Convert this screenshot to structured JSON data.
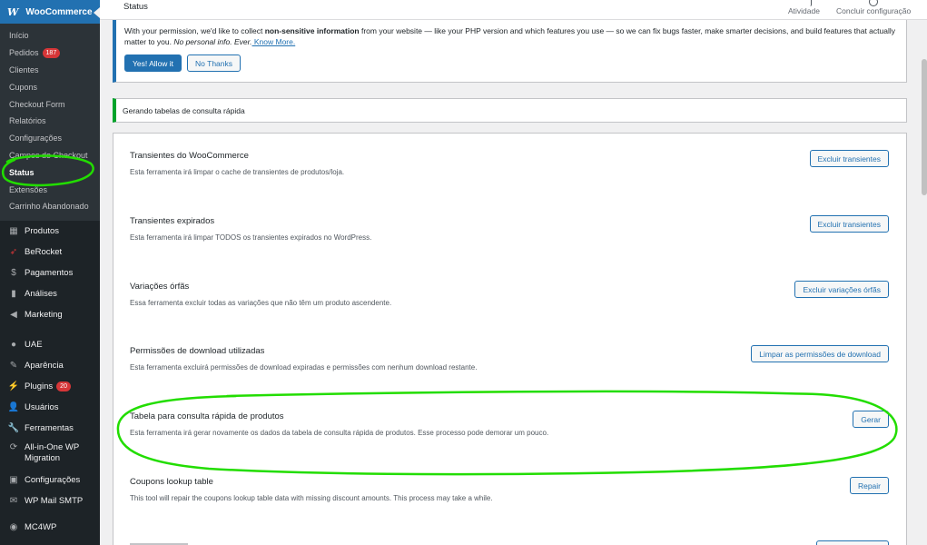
{
  "sidebar": {
    "woocommerce_label": "WooCommerce",
    "sub_items": [
      {
        "label": "Início"
      },
      {
        "label": "Pedidos",
        "badge": "187"
      },
      {
        "label": "Clientes"
      },
      {
        "label": "Cupons"
      },
      {
        "label": "Checkout Form"
      },
      {
        "label": "Relatórios"
      },
      {
        "label": "Configurações"
      },
      {
        "label": "Campos do Checkout"
      },
      {
        "label": "Status"
      },
      {
        "label": "Extensões"
      },
      {
        "label": "Carrinho Abandonado"
      }
    ],
    "menu_items": [
      {
        "label": "Produtos",
        "icon": "products-icon"
      },
      {
        "label": "BeRocket",
        "icon": "berocket-icon"
      },
      {
        "label": "Pagamentos",
        "icon": "payments-icon"
      },
      {
        "label": "Análises",
        "icon": "analytics-icon"
      },
      {
        "label": "Marketing",
        "icon": "marketing-icon"
      },
      {
        "label": "UAE",
        "icon": "uae-icon"
      },
      {
        "label": "Aparência",
        "icon": "appearance-icon"
      },
      {
        "label": "Plugins",
        "icon": "plugins-icon",
        "badge": "20"
      },
      {
        "label": "Usuários",
        "icon": "users-icon"
      },
      {
        "label": "Ferramentas",
        "icon": "tools-icon"
      },
      {
        "label": "All-in-One WP",
        "label2": "Migration",
        "icon": "migration-icon"
      },
      {
        "label": "Configurações",
        "icon": "settings-icon"
      },
      {
        "label": "WP Mail SMTP",
        "icon": "mail-icon"
      },
      {
        "label": "MC4WP",
        "icon": "mc4wp-icon"
      }
    ]
  },
  "topbar": {
    "title": "Status",
    "activity": "Atividade",
    "finish_setup": "Concluir configuração"
  },
  "tracker_notice": {
    "text_1": "With your permission, we'd like to collect ",
    "text_bold": "non-sensitive information",
    "text_2": " from your website — like your PHP version and which features you use — so we can fix bugs faster, make smarter decisions, and build features that actually matter to you. ",
    "text_em": "No personal info. Ever.",
    "link": " Know More.",
    "allow_label": "Yes! Allow it",
    "deny_label": "No Thanks"
  },
  "gen_notice": "Gerando tabelas de consulta rápida",
  "tools": [
    {
      "name": "Transientes do WooCommerce",
      "desc": "Esta ferramenta irá limpar o cache de transientes de produtos/loja.",
      "button": "Excluir transientes"
    },
    {
      "name": "Transientes expirados",
      "desc": "Esta ferramenta irá limpar TODOS os transientes expirados no WordPress.",
      "button": "Excluir transientes"
    },
    {
      "name": "Variações órfãs",
      "desc": "Essa ferramenta excluir todas as variações que não têm um produto ascendente.",
      "button": "Excluir variações órfãs"
    },
    {
      "name": "Permissões de download utilizadas",
      "desc": "Esta ferramenta excluirá permissões de download expiradas e permissões com nenhum download restante.",
      "button": "Limpar as permissões de download"
    },
    {
      "name": "Tabela para consulta rápida de produtos",
      "desc": "Esta ferramenta irá gerar novamente os dados da tabela de consulta rápida de produtos. Esse processo pode demorar um pouco.",
      "button": "Gerar"
    },
    {
      "name": "Coupons lookup table",
      "desc": "This tool will repair the coupons lookup table data with missing discount amounts. This process may take a while.",
      "button": "Repair"
    }
  ],
  "colors": {
    "sidebar_bg": "#1d2327",
    "accent": "#2271b1",
    "success": "#00a32a",
    "annotation": "#22dd00"
  }
}
